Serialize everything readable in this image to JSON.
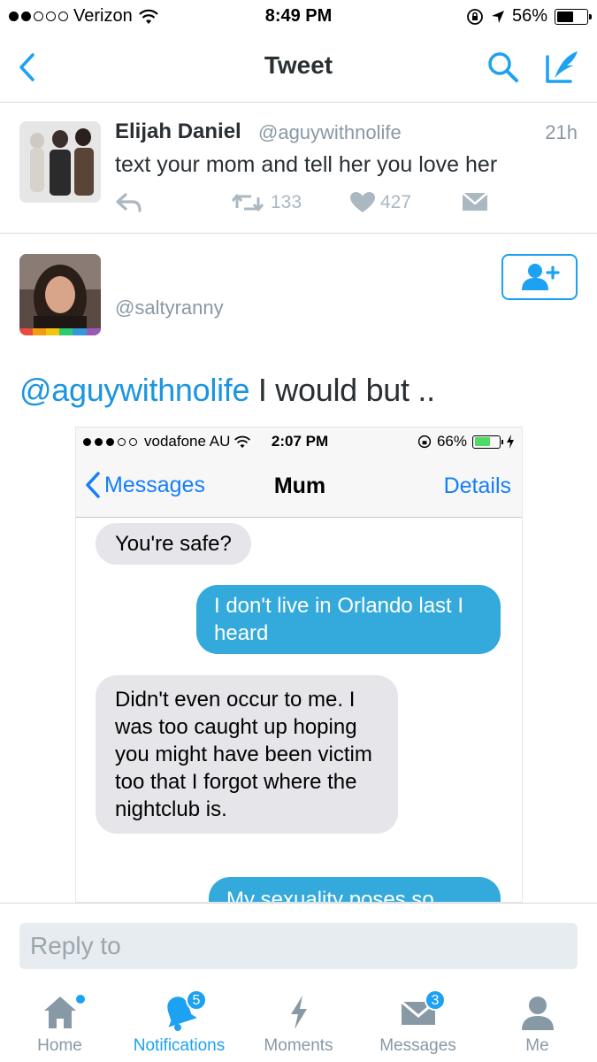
{
  "status_bar": {
    "carrier": "Verizon",
    "time": "8:49 PM",
    "battery": "56%",
    "battery_level": 0.56
  },
  "nav": {
    "title": "Tweet"
  },
  "original_tweet": {
    "name": "Elijah Daniel",
    "handle": "@aguywithnolife",
    "time": "21h",
    "text": "text your mom and tell her you love her",
    "retweets": "133",
    "likes": "427"
  },
  "reply_tweet": {
    "handle": "@saltyranny",
    "mention": "@aguywithnolife",
    "text": " I would but .."
  },
  "photo": {
    "status": {
      "carrier": "vodafone AU",
      "time": "2:07 PM",
      "battery": "66%",
      "battery_level": 0.66
    },
    "nav": {
      "back": "Messages",
      "title": "Mum",
      "details": "Details"
    },
    "messages": [
      {
        "from": "in",
        "text": "You're safe?"
      },
      {
        "from": "out",
        "text": "I don't live in Orlando last I heard"
      },
      {
        "from": "in",
        "text": "Didn't even occur to me. I was too caught up hoping you might have been victim too that I forgot where the nightclub is."
      },
      {
        "from": "out",
        "text": "My sexuality poses so..."
      }
    ]
  },
  "reply_bar": {
    "placeholder": "Reply to"
  },
  "tabs": [
    {
      "label": "Home",
      "icon": "home-icon",
      "badge": ""
    },
    {
      "label": "Notifications",
      "icon": "bell-icon",
      "badge": "5"
    },
    {
      "label": "Moments",
      "icon": "lightning-icon",
      "badge": ""
    },
    {
      "label": "Messages",
      "icon": "envelope-icon",
      "badge": "3"
    },
    {
      "label": "Me",
      "icon": "person-icon",
      "badge": ""
    }
  ],
  "colors": {
    "accent": "#1da1f2",
    "mention": "#1b95e0",
    "imessage_blue": "#34aadc",
    "imessage_gray": "#e5e5ea",
    "muted": "#8899a6"
  }
}
